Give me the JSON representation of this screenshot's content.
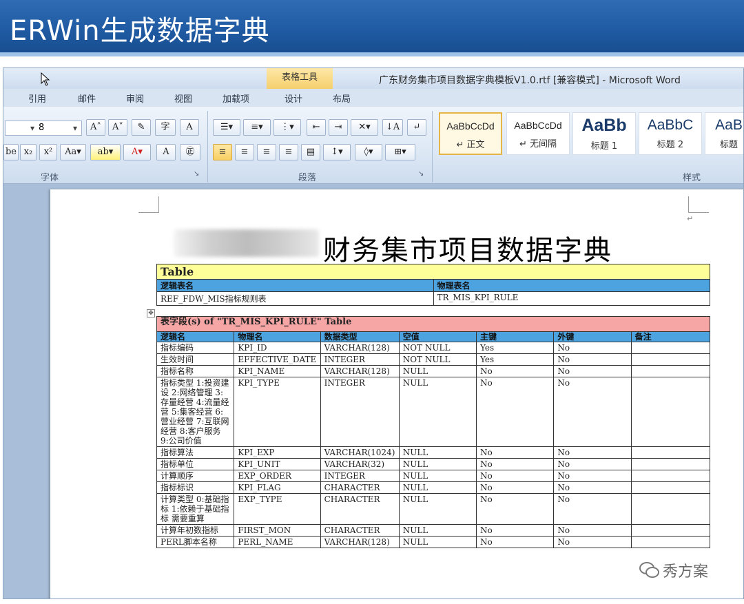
{
  "slide": {
    "title": "ERWin生成数据字典"
  },
  "word": {
    "context_tab": "表格工具",
    "window_title": "广东财务集市项目数据字典模板V1.0.rtf [兼容模式] - Microsoft Word",
    "ribbon_tabs": [
      "引用",
      "邮件",
      "审阅",
      "视图",
      "加载项",
      "设计",
      "布局"
    ],
    "font_size": "8",
    "groups": {
      "font": "字体",
      "paragraph": "段落",
      "styles": "样式"
    },
    "styles": [
      {
        "sample": "AaBbCcDd",
        "name": "↵ 正文",
        "selected": true
      },
      {
        "sample": "AaBbCcDd",
        "name": "↵ 无间隔",
        "selected": false
      },
      {
        "sample": "AaBb",
        "name": "标题 1",
        "selected": false
      },
      {
        "sample": "AaBbC",
        "name": "标题 2",
        "selected": false
      },
      {
        "sample": "AaB",
        "name": "标题",
        "selected": false
      }
    ]
  },
  "document": {
    "title": "财务集市项目数据字典",
    "table_info": {
      "label": "Table",
      "headers": [
        "逻辑表名",
        "物理表名"
      ],
      "values": [
        "REF_FDW_MIS指标规则表",
        "TR_MIS_KPI_RULE"
      ]
    },
    "fields_table": {
      "caption": "表字段(s) of \"TR_MIS_KPI_RULE\" Table",
      "headers": [
        "逻辑名",
        "物理名",
        "数据类型",
        "空值",
        "主键",
        "外键",
        "备注"
      ],
      "rows": [
        [
          "指标编码",
          "KPI_ID",
          "VARCHAR(128)",
          "NOT NULL",
          "Yes",
          "No",
          ""
        ],
        [
          "生效时间",
          "EFFECTIVE_DATE",
          "INTEGER",
          "NOT NULL",
          "Yes",
          "No",
          ""
        ],
        [
          "指标名称",
          "KPI_NAME",
          "VARCHAR(128)",
          "NULL",
          "No",
          "No",
          ""
        ],
        [
          "指标类型 1:投资建设 2:网络管理 3:存量经营 4:流量经营 5:集客经营 6:营业经营 7:互联网经营 8:客户服务 9:公司价值",
          "KPI_TYPE",
          "INTEGER",
          "NULL",
          "No",
          "No",
          ""
        ],
        [
          "指标算法",
          "KPI_EXP",
          "VARCHAR(1024)",
          "NULL",
          "No",
          "No",
          ""
        ],
        [
          "指标单位",
          "KPI_UNIT",
          "VARCHAR(32)",
          "NULL",
          "No",
          "No",
          ""
        ],
        [
          "计算顺序",
          "EXP_ORDER",
          "INTEGER",
          "NULL",
          "No",
          "No",
          ""
        ],
        [
          "指标标识",
          "KPI_FLAG",
          "CHARACTER",
          "NULL",
          "No",
          "No",
          ""
        ],
        [
          "计算类型 0:基础指标 1:依赖于基础指标 需要重算",
          "EXP_TYPE",
          "CHARACTER",
          "NULL",
          "No",
          "No",
          ""
        ],
        [
          "计算年初数指标",
          "FIRST_MON",
          "CHARACTER",
          "NULL",
          "No",
          "No",
          ""
        ],
        [
          "PERL脚本名称",
          "PERL_NAME",
          "VARCHAR(128)",
          "NULL",
          "No",
          "No",
          ""
        ]
      ]
    }
  },
  "watermark": {
    "text": "秀方案"
  }
}
